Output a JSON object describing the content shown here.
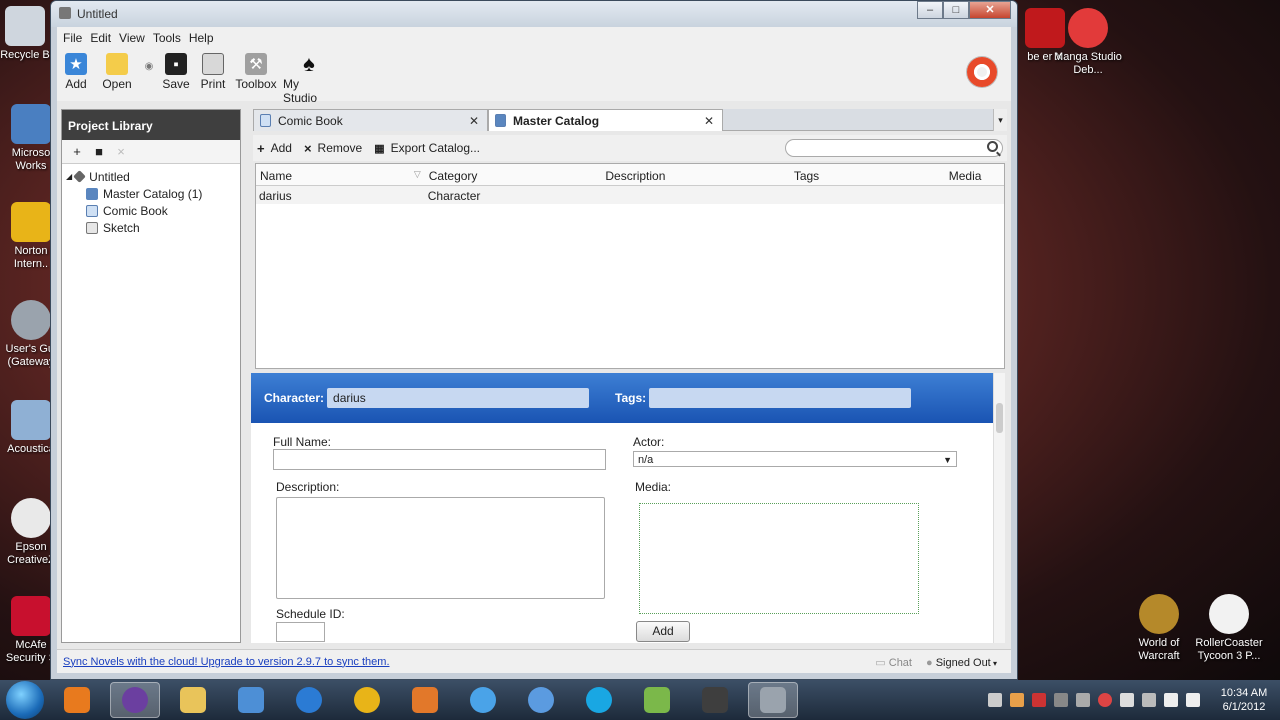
{
  "desktop": {
    "left_icons": [
      {
        "label": "Recycle B"
      },
      {
        "label": "Microso Works"
      },
      {
        "label": "Norton Intern.."
      },
      {
        "label": "User's Gui (Gateway"
      },
      {
        "label": "Acoustica"
      },
      {
        "label": "Epson CreativeZ"
      },
      {
        "label": "McAfe Security S"
      }
    ],
    "right_icons": [
      {
        "label": "be er X"
      },
      {
        "label": "Manga Studio Deb..."
      },
      {
        "label": "World of Warcraft"
      },
      {
        "label": "RollerCoaster Tycoon 3 P..."
      }
    ]
  },
  "window": {
    "title": "Untitled",
    "controls": {
      "minimize": "–",
      "maximize": "□",
      "close": "✕"
    }
  },
  "menu": [
    "File",
    "Edit",
    "View",
    "Tools",
    "Help"
  ],
  "toolbar": {
    "add": "Add",
    "open": "Open",
    "save": "Save",
    "print": "Print",
    "toolbox": "Toolbox",
    "my_studio": "My Studio"
  },
  "sidebar": {
    "title": "Project Library",
    "tools": [
      "+",
      "■",
      "×"
    ],
    "tree": {
      "root": "Untitled",
      "items": [
        "Master Catalog (1)",
        "Comic Book",
        "Sketch"
      ]
    }
  },
  "tabs": [
    {
      "label": "Comic Book",
      "active": false
    },
    {
      "label": "Master Catalog",
      "active": true
    }
  ],
  "actions": {
    "add": "Add",
    "remove": "Remove",
    "export": "Export Catalog..."
  },
  "search": {
    "placeholder": ""
  },
  "grid": {
    "columns": [
      "Name",
      "Category",
      "Description",
      "Tags",
      "Media"
    ],
    "rows": [
      {
        "name": "darius",
        "category": "Character",
        "description": "",
        "tags": "",
        "media": ""
      }
    ]
  },
  "detail": {
    "character_label": "Character:",
    "character_value": "darius",
    "tags_label": "Tags:",
    "tags_value": "",
    "full_name_label": "Full Name:",
    "full_name_value": "",
    "actor_label": "Actor:",
    "actor_value": "n/a",
    "description_label": "Description:",
    "media_label": "Media:",
    "schedule_label": "Schedule ID:",
    "add_button": "Add"
  },
  "status": {
    "sync_link": "Sync Novels with the cloud! Upgrade to version 2.9.7 to sync them.",
    "chat": "Chat",
    "signed_out": "Signed Out"
  },
  "clock": {
    "time": "10:34 AM",
    "date": "6/1/2012"
  }
}
